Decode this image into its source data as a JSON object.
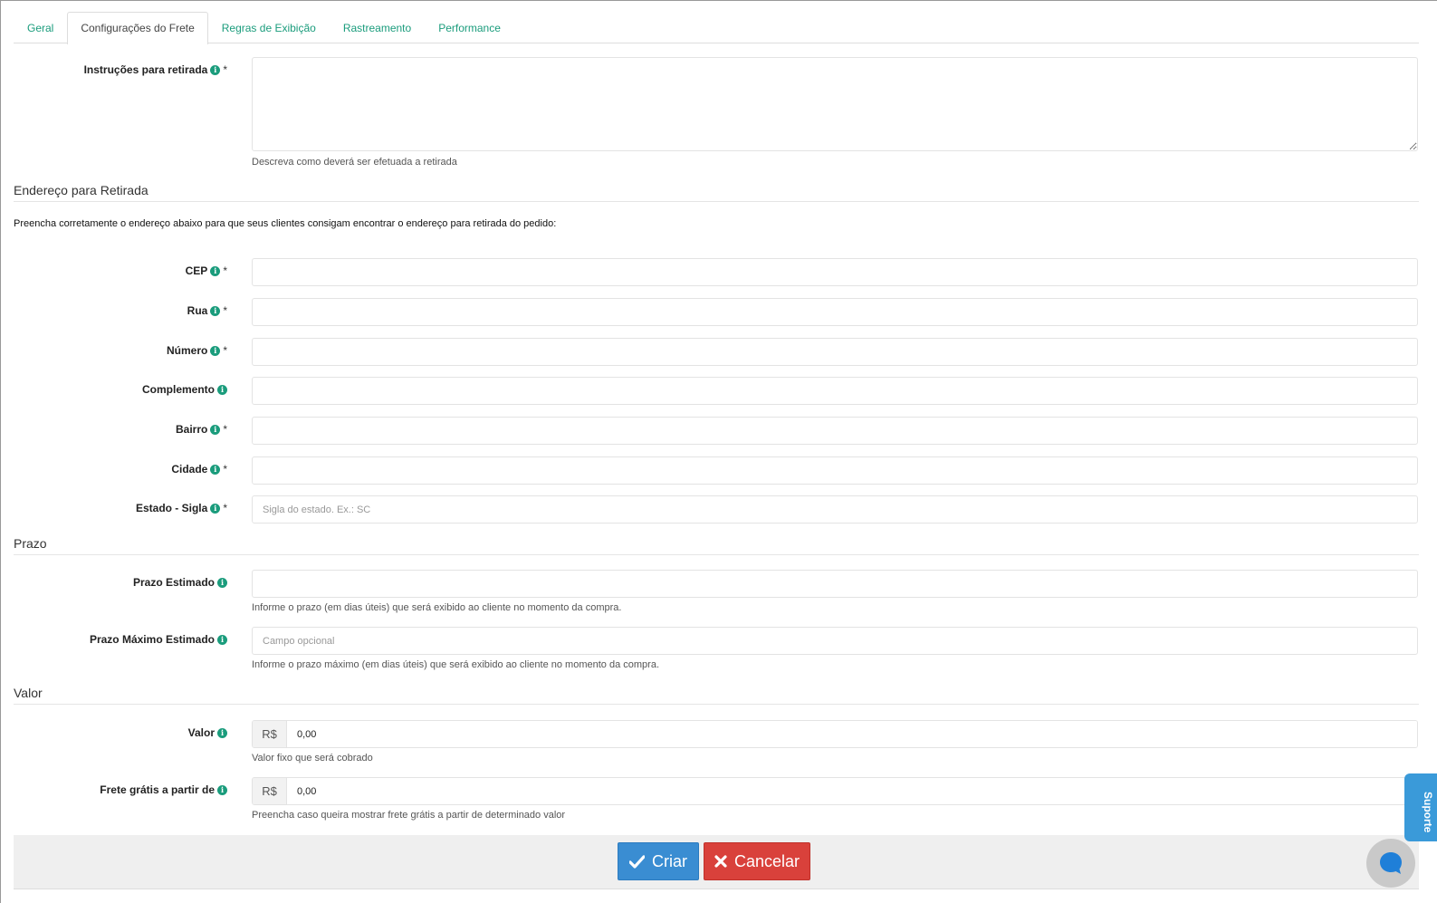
{
  "tabs": [
    {
      "label": "Geral"
    },
    {
      "label": "Configurações do Frete"
    },
    {
      "label": "Regras de Exibição"
    },
    {
      "label": "Rastreamento"
    },
    {
      "label": "Performance"
    }
  ],
  "instructions": {
    "label": "Instruções para retirada",
    "required": "*",
    "value": "",
    "help": "Descreva como deverá ser efetuada a retirada"
  },
  "address_section": {
    "title": "Endereço para Retirada",
    "intro": "Preencha corretamente o endereço abaixo para que seus clientes consigam encontrar o endereço para retirada do pedido:",
    "fields": {
      "cep": {
        "label": "CEP",
        "required": "*",
        "value": ""
      },
      "rua": {
        "label": "Rua",
        "required": "*",
        "value": ""
      },
      "numero": {
        "label": "Número",
        "required": "*",
        "value": ""
      },
      "complemento": {
        "label": "Complemento",
        "value": ""
      },
      "bairro": {
        "label": "Bairro",
        "required": "*",
        "value": ""
      },
      "cidade": {
        "label": "Cidade",
        "required": "*",
        "value": ""
      },
      "estado": {
        "label": "Estado - Sigla",
        "required": "*",
        "value": "",
        "placeholder": "Sigla do estado. Ex.: SC"
      }
    }
  },
  "prazo_section": {
    "title": "Prazo",
    "estimado": {
      "label": "Prazo Estimado",
      "value": "",
      "help": "Informe o prazo (em dias úteis) que será exibido ao cliente no momento da compra."
    },
    "maximo": {
      "label": "Prazo Máximo Estimado",
      "value": "",
      "placeholder": "Campo opcional",
      "help": "Informe o prazo máximo (em dias úteis) que será exibido ao cliente no momento da compra."
    }
  },
  "valor_section": {
    "title": "Valor",
    "valor": {
      "label": "Valor",
      "currency": "R$",
      "value": "0,00",
      "help": "Valor fixo que será cobrado"
    },
    "frete_gratis": {
      "label": "Frete grátis a partir de",
      "currency": "R$",
      "value": "0,00",
      "help": "Preencha caso queira mostrar frete grátis a partir de determinado valor"
    }
  },
  "actions": {
    "create_label": "Criar",
    "cancel_label": "Cancelar"
  },
  "support": {
    "label": "Suporte"
  },
  "colors": {
    "accent": "#1a9c7c",
    "primary": "#3a8dd2",
    "danger": "#d9413b"
  }
}
